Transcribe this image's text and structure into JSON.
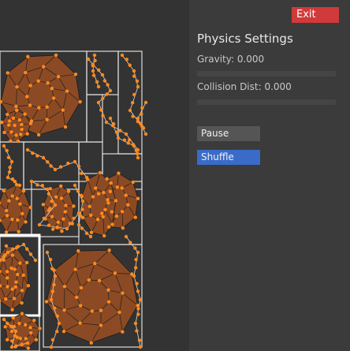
{
  "header": {
    "exit_label": "Exit"
  },
  "panel": {
    "title": "Physics Settings",
    "gravity_label": "Gravity: 0.000",
    "gravity_value": 0.0,
    "collision_label": "Collision Dist: 0.000",
    "collision_value": 0.0,
    "pause_label": "Pause",
    "shuffle_label": "Shuffle"
  },
  "colors": {
    "background": "#333333",
    "panel": "#3b3b3b",
    "exit_button": "#d03a3a",
    "shuffle_button": "#3a6bc9",
    "pause_button": "#555555",
    "shape_fill": "#8b4a24",
    "node": "#ff8a1e",
    "outline": "#dddddd"
  }
}
